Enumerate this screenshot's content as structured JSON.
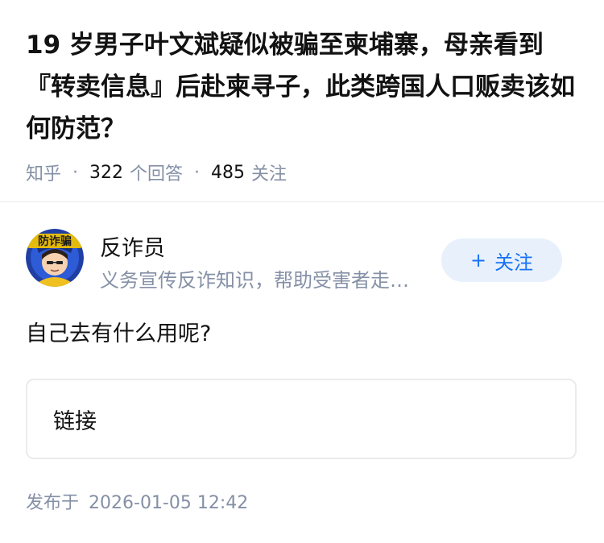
{
  "question": {
    "title": "19 岁男子叶文斌疑似被骗至柬埔寨，母亲看到『转卖信息』后赴柬寻子，此类跨国人口贩卖该如何防范？",
    "source": "知乎",
    "answer_count": "322",
    "answer_label": "个回答",
    "follower_count": "485",
    "follower_label": "关注"
  },
  "author": {
    "name": "反诈员",
    "bio": "义务宣传反诈知识，帮助受害者走…",
    "avatar_text": "防诈骗",
    "follow_label": "关注",
    "follow_icon": "plus-icon"
  },
  "answer": {
    "text": "自己去有什么用呢?",
    "link_label": "链接"
  },
  "publish": {
    "label": "发布于",
    "time": "2026-01-05 12:42"
  },
  "colors": {
    "accent": "#1772f6",
    "follow_bg": "#e8f1fb",
    "meta_gray": "#8590a6",
    "border": "#ebebeb"
  }
}
